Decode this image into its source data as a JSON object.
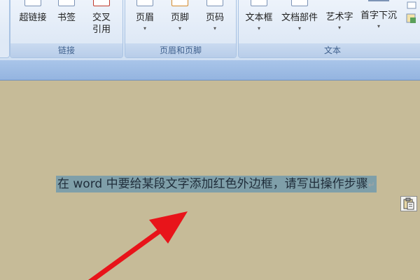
{
  "ribbon": {
    "groups": {
      "links": {
        "label": "链接",
        "items": [
          {
            "label": "超链接",
            "icon": "hyperlink-icon"
          },
          {
            "label": "书签",
            "icon": "bookmark-icon"
          },
          {
            "label": "交叉",
            "label2": "引用",
            "icon": "cross-reference-icon"
          }
        ]
      },
      "header_footer": {
        "label": "页眉和页脚",
        "items": [
          {
            "label": "页眉",
            "dropdown": "▾",
            "icon": "header-icon"
          },
          {
            "label": "页脚",
            "dropdown": "▾",
            "icon": "footer-icon"
          },
          {
            "label": "页码",
            "dropdown": "▾",
            "icon": "page-number-icon"
          }
        ]
      },
      "text": {
        "label": "文本",
        "items": [
          {
            "label": "文本框",
            "dropdown": "▾",
            "icon": "text-box-icon"
          },
          {
            "label": "文档部件",
            "dropdown": "▾",
            "icon": "quick-parts-icon"
          },
          {
            "label": "艺术字",
            "dropdown": "▾",
            "icon": "wordart-icon"
          },
          {
            "label": "首字下沉",
            "dropdown": "▾",
            "icon": "drop-cap-icon"
          }
        ]
      }
    }
  },
  "document": {
    "selected_text": "在 word 中要给某段文字添加红色外边框，请写出操作步骤",
    "paragraph_mark": "↵"
  },
  "colors": {
    "document_bg": "#c6bb98",
    "selection": "#7f9fa9",
    "annotation_arrow": "#e8141a",
    "ribbon_label": "#3e5f8c"
  }
}
